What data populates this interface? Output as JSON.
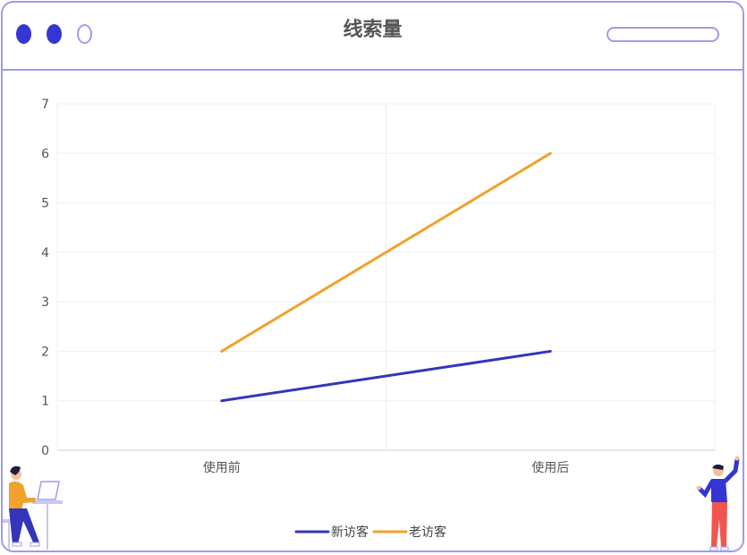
{
  "window": {
    "title": "线索量",
    "dot_colors": [
      "#3535d4",
      "#3535d4",
      "hollow"
    ],
    "border_color": "#9d9cf0"
  },
  "chart_data": {
    "type": "line",
    "title": "线索量",
    "categories": [
      "使用前",
      "使用后"
    ],
    "ylim": [
      0,
      7
    ],
    "yticks": [
      0,
      1,
      2,
      3,
      4,
      5,
      6,
      7
    ],
    "grid": true,
    "legend_position": "bottom-center",
    "series": [
      {
        "name": "新访客",
        "values": [
          1,
          2
        ],
        "color": "#3535b8"
      },
      {
        "name": "老访客",
        "values": [
          2,
          6
        ],
        "color": "#f0a22e"
      }
    ]
  },
  "decorations": [
    "person-at-laptop-illustration",
    "person-pointing-illustration"
  ]
}
